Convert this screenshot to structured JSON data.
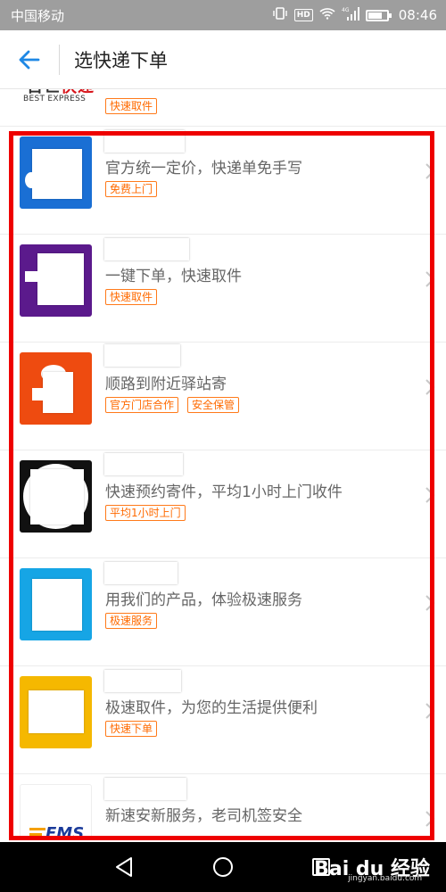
{
  "status_bar": {
    "carrier": "中国移动",
    "network": "4G",
    "hd": "HD",
    "time": "08:46"
  },
  "header": {
    "back_icon": "arrow-left-icon",
    "title": "选快递下单"
  },
  "list": [
    {
      "logo_text_cn": "百世快递",
      "logo_text_en": "BEST EXPRESS",
      "desc": "",
      "tags": [
        "快速取件"
      ]
    },
    {
      "logo_color": "#1a6fd4",
      "desc": "官方统一定价，快递单免手写",
      "tags": [
        "免费上门"
      ]
    },
    {
      "logo_color": "#5b1a8c",
      "desc": "一键下单，快速取件",
      "tags": [
        "快速取件"
      ]
    },
    {
      "logo_color": "#ee4b10",
      "desc": "顺路到附近驿站寄",
      "tags": [
        "官方门店合作",
        "安全保管"
      ]
    },
    {
      "logo_color": "#111111",
      "desc": "快速预约寄件，平均1小时上门收件",
      "tags": [
        "平均1小时上门"
      ]
    },
    {
      "logo_color": "#16a5e5",
      "desc": "用我们的产品，体验极速服务",
      "tags": [
        "极速服务"
      ]
    },
    {
      "logo_color": "#f5b800",
      "desc": "极速取件，为您的生活提供便利",
      "tags": [
        "快速下单"
      ]
    },
    {
      "logo_text": "EMS",
      "desc": "新速安新服务，老司机签安全",
      "tags": []
    }
  ],
  "nav_bar": {
    "back_icon": "triangle-back-icon",
    "home_icon": "circle-home-icon",
    "recents_icon": "square-recents-icon",
    "watermark_main": "Bai du 经验",
    "watermark_sub": "jingyan.baidu.com"
  }
}
